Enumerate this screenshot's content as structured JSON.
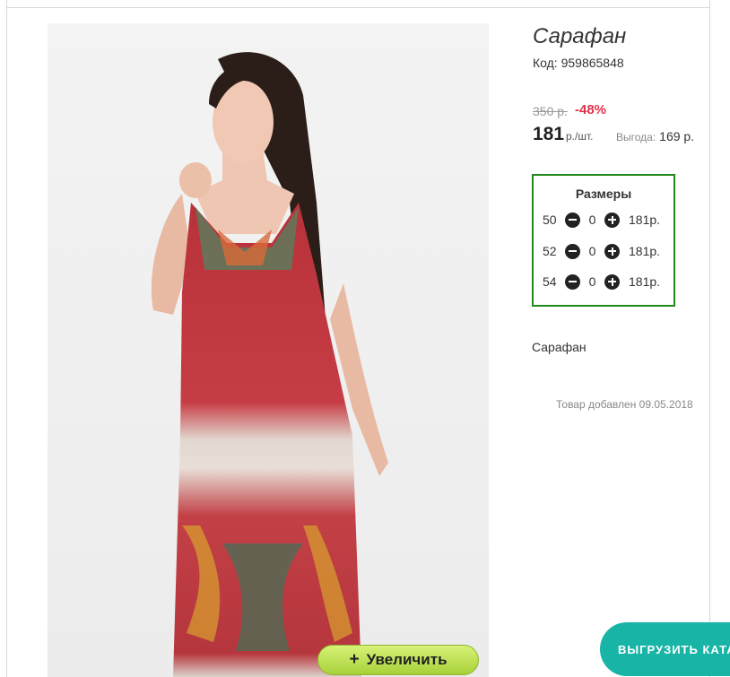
{
  "product": {
    "title": "Сарафан",
    "code": "Код: 959865848",
    "old_price": "350 р.",
    "discount": "-48%",
    "price": "181",
    "price_unit": "р./шт.",
    "benefit_label": "Выгода:",
    "benefit_value": "169 р.",
    "description": "Сарафан",
    "added_date": "Товар добавлен 09.05.2018"
  },
  "sizes": {
    "title": "Размеры",
    "rows": [
      {
        "size": "50",
        "qty": "0",
        "price": "181р."
      },
      {
        "size": "52",
        "qty": "0",
        "price": "181р."
      },
      {
        "size": "54",
        "qty": "0",
        "price": "181р."
      }
    ]
  },
  "buttons": {
    "zoom_plus": "+",
    "zoom_label": "Увеличить",
    "export_label": "ВЫГРУЗИТЬ КАТА"
  },
  "colors": {
    "sizes_border": "#1e8a1e",
    "discount": "#e0324b",
    "zoom_button": "#a7d23a",
    "export_button": "#18b5a6"
  }
}
